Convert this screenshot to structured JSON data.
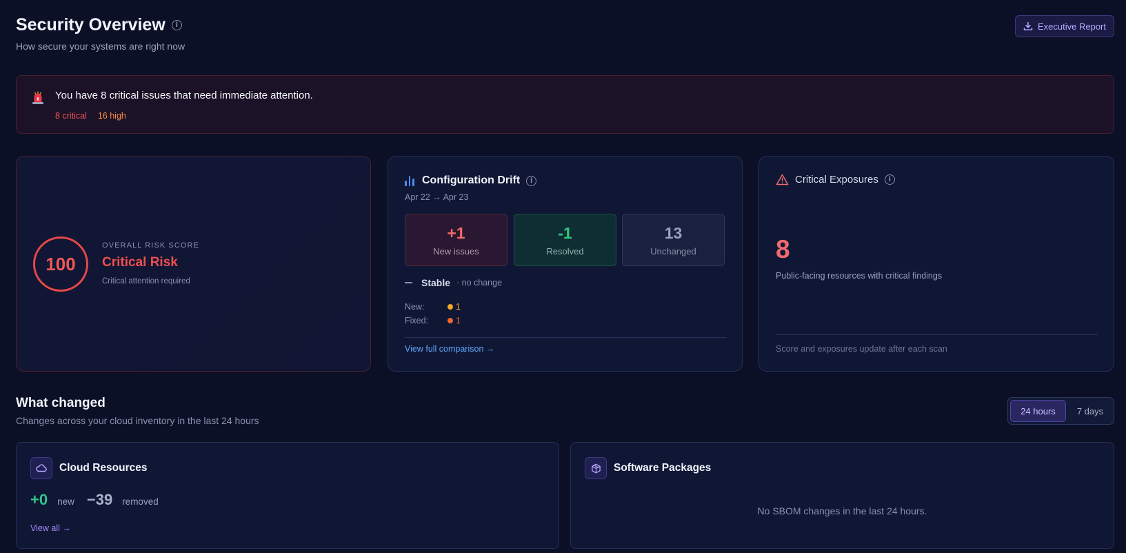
{
  "header": {
    "title": "Security Overview",
    "subtitle": "How secure your systems are right now",
    "report_button": "Executive Report"
  },
  "alert": {
    "message": "You have 8 critical issues that need immediate attention.",
    "critical": "8 critical",
    "high": "16 high",
    "colors": {
      "critical": "#f05252",
      "high": "#fb8a3c"
    }
  },
  "risk": {
    "score": "100",
    "label": "OVERALL RISK SCORE",
    "level": "Critical Risk",
    "note": "Critical attention required"
  },
  "drift": {
    "title": "Configuration Drift",
    "dates": "Apr 22 → Apr 23",
    "stats": [
      {
        "value": "+1",
        "label": "New issues"
      },
      {
        "value": "-1",
        "label": "Resolved"
      },
      {
        "value": "13",
        "label": "Unchanged"
      }
    ],
    "stable_label": "Stable",
    "stable_note": "· no change",
    "new_label": "New:",
    "new_value": "1",
    "fixed_label": "Fixed:",
    "fixed_value": "1",
    "link": "View full comparison →"
  },
  "exposures": {
    "title": "Critical Exposures",
    "count": "8",
    "description": "Public-facing resources with critical findings",
    "footer": "Score and exposures update after each scan"
  },
  "what_changed": {
    "title": "What changed",
    "subtitle": "Changes across your cloud inventory in the last 24 hours",
    "toggle": [
      "24 hours",
      "7 days"
    ],
    "selected": "24 hours"
  },
  "cloud": {
    "title": "Cloud Resources",
    "new_value": "+0",
    "new_label": "new",
    "removed_value": "−39",
    "removed_label": "removed",
    "link": "View all →"
  },
  "software": {
    "title": "Software Packages",
    "empty": "No SBOM changes in the last 24 hours."
  },
  "icons": {
    "info": "info-icon",
    "download": "download-icon",
    "alert": "siren-icon",
    "chart": "bar-chart-icon",
    "warning": "warning-triangle-icon",
    "cloud": "cloud-icon",
    "package": "package-icon"
  },
  "colors": {
    "background": "#0b1026",
    "accent": "#a78bfa",
    "danger": "#ef4f4f",
    "success": "#34c77b",
    "link": "#60a5fa"
  }
}
